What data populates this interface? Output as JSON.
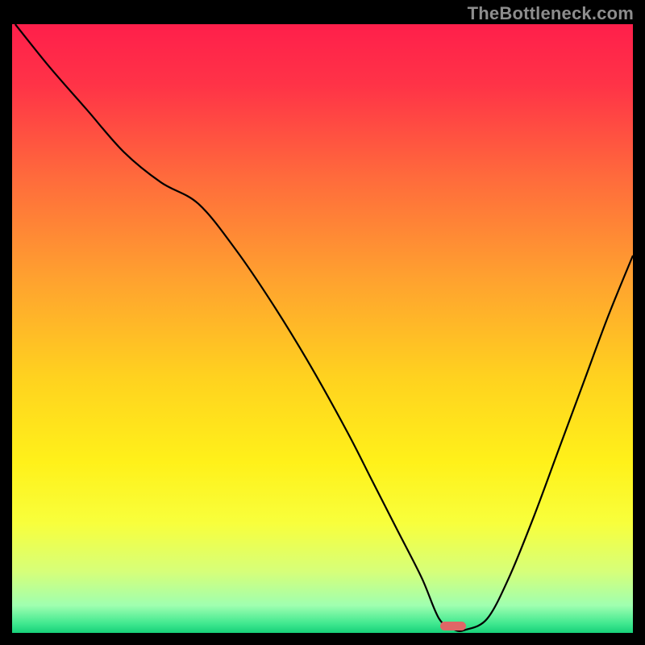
{
  "watermark": "TheBottleneck.com",
  "chart_data": {
    "type": "line",
    "title": "",
    "xlabel": "",
    "ylabel": "",
    "xlim": [
      0,
      100
    ],
    "ylim": [
      0,
      100
    ],
    "grid": false,
    "legend": false,
    "background_gradient_stops": [
      {
        "offset": 0.0,
        "color": "#ff1f4b"
      },
      {
        "offset": 0.1,
        "color": "#ff3347"
      },
      {
        "offset": 0.25,
        "color": "#ff6a3c"
      },
      {
        "offset": 0.42,
        "color": "#ffa22f"
      },
      {
        "offset": 0.58,
        "color": "#ffd21f"
      },
      {
        "offset": 0.72,
        "color": "#fff11a"
      },
      {
        "offset": 0.82,
        "color": "#f8ff3c"
      },
      {
        "offset": 0.9,
        "color": "#d6ff7a"
      },
      {
        "offset": 0.955,
        "color": "#9fffb0"
      },
      {
        "offset": 0.985,
        "color": "#3fe88f"
      },
      {
        "offset": 1.0,
        "color": "#17d17a"
      }
    ],
    "series": [
      {
        "name": "bottleneck-curve",
        "color": "#000000",
        "width": 2.2,
        "x": [
          0.5,
          6,
          12,
          18,
          24,
          30,
          36,
          42,
          48,
          54,
          58,
          62,
          66,
          68.8,
          71.3,
          73,
          76.5,
          80,
          84,
          88,
          92,
          96,
          100
        ],
        "y": [
          100,
          93,
          86,
          79,
          74,
          70.5,
          63,
          54,
          44,
          33,
          25,
          17,
          9,
          2.3,
          0.5,
          0.5,
          2.3,
          9,
          19,
          30,
          41,
          52,
          62
        ]
      }
    ],
    "marker": {
      "name": "optimal-range",
      "color": "#e06666",
      "x_center": 71,
      "width_pct": 4.2,
      "y_bottom_pct": 0.4,
      "height_pct": 1.5
    }
  }
}
